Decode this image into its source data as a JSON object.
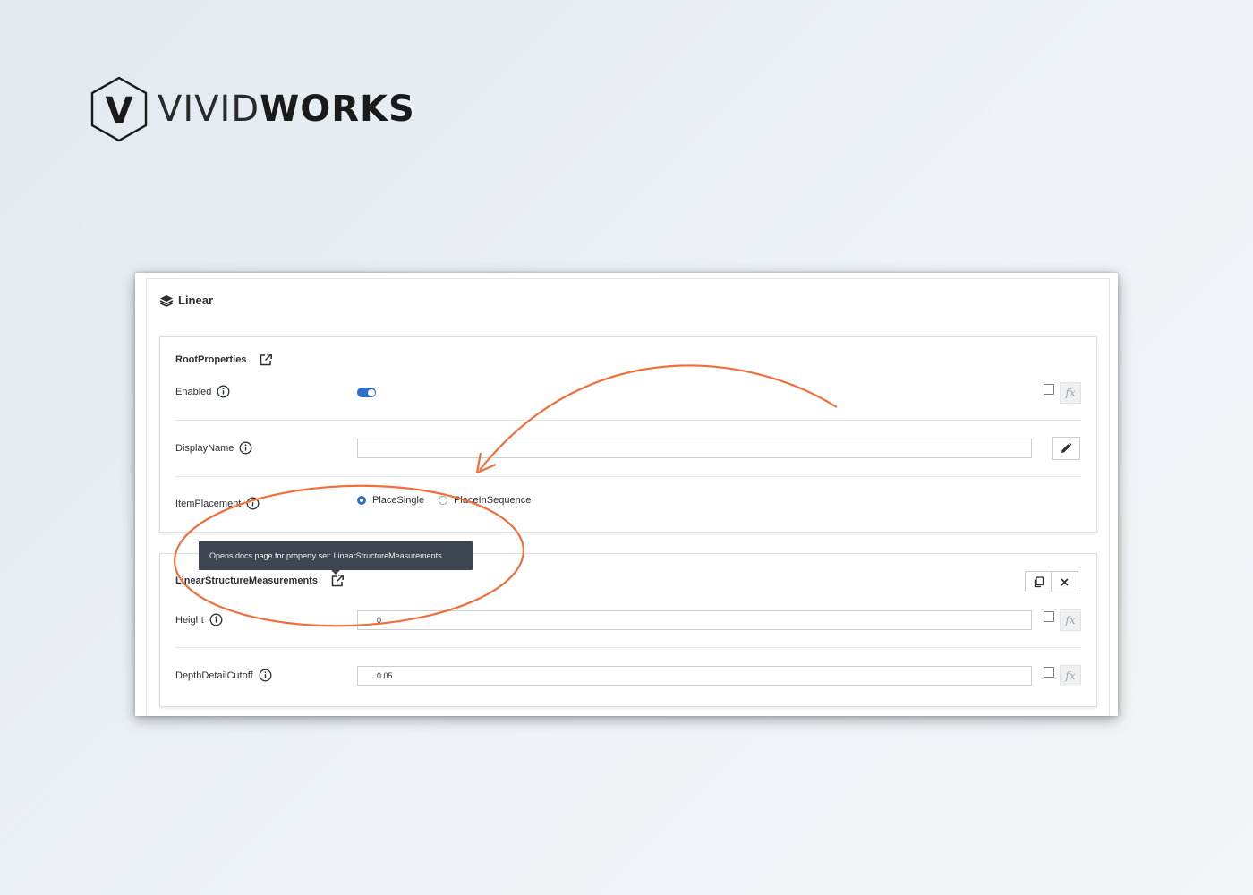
{
  "brand": {
    "logo_letter": "V",
    "name_light": "VIVID",
    "name_bold": "WORKS",
    "accent_color": "#f0703d"
  },
  "panel": {
    "title": "Linear",
    "title_icon": "layers-icon"
  },
  "root_properties": {
    "title": "RootProperties",
    "enabled_label": "Enabled",
    "enabled_value": true,
    "display_name_label": "DisplayName",
    "display_name_value": "",
    "item_placement_label": "ItemPlacement",
    "item_placement_options": [
      "PlaceSingle",
      "PlaceInSequence"
    ],
    "item_placement_selected": "PlaceSingle"
  },
  "tooltip": {
    "text": "Opens docs page for property set: LinearStructureMeasurements"
  },
  "linear_structure": {
    "title": "LinearStructureMeasurements",
    "height_label": "Height",
    "height_value": "0",
    "depth_label": "DepthDetailCutoff",
    "depth_value": "0.05"
  },
  "fx_label": "fx",
  "colors": {
    "primary_blue": "#2f6fcc",
    "tooltip_bg": "#3d4650",
    "annotation_orange": "#f0703d"
  }
}
